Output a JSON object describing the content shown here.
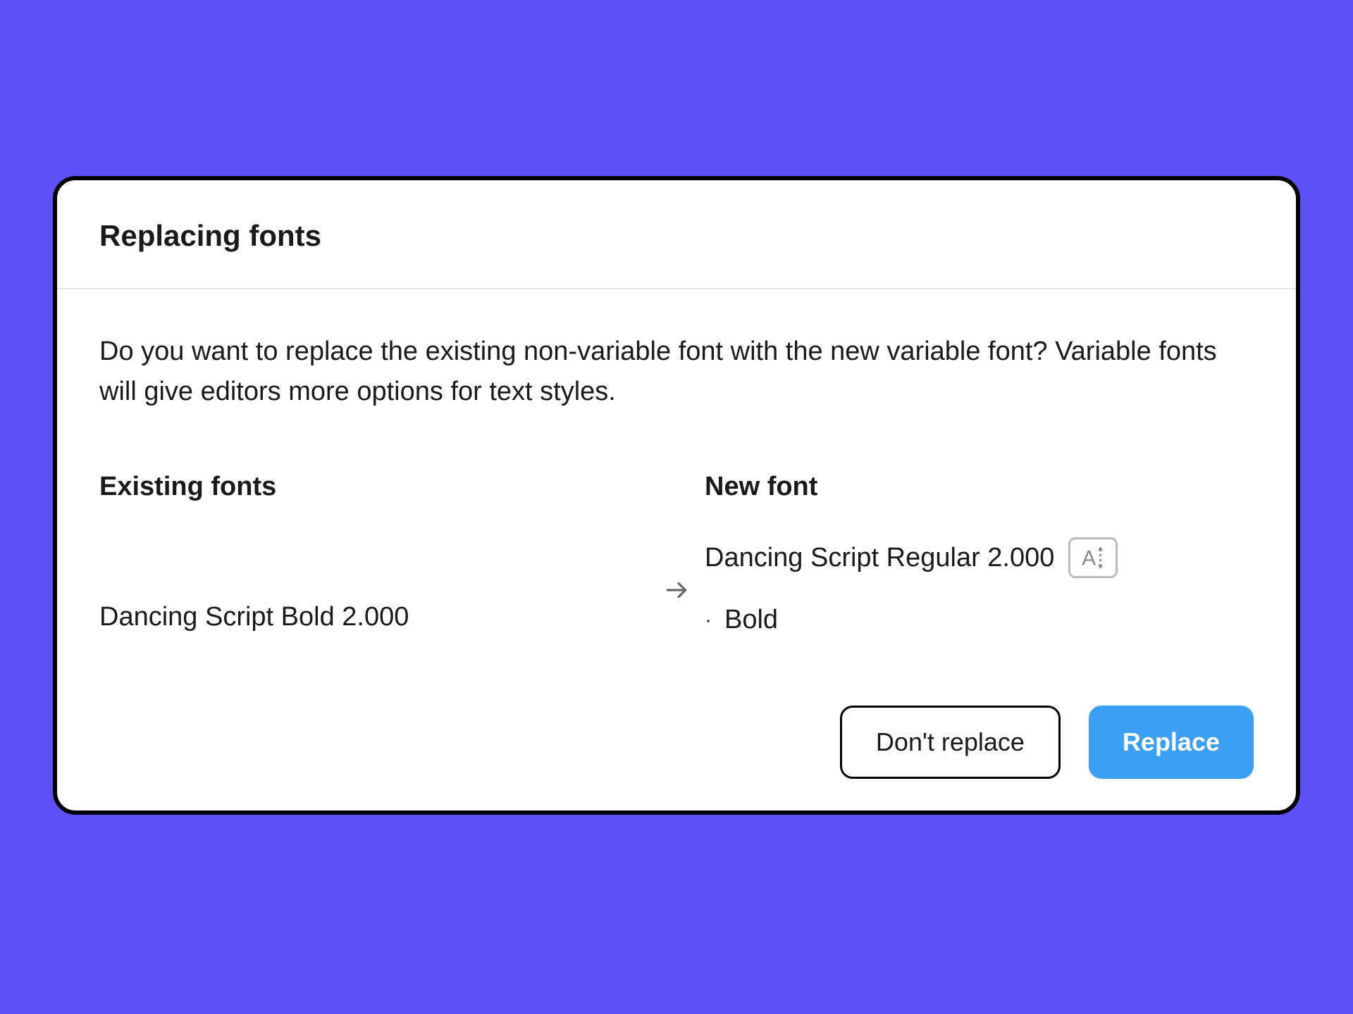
{
  "dialog": {
    "title": "Replacing fonts",
    "description": "Do you want to replace the existing non-variable font with the new variable font? Variable fonts will give editors more options for text styles.",
    "existing_heading": "Existing fonts",
    "new_heading": "New font",
    "existing_font": "Dancing Script Bold 2.000",
    "new_font": "Dancing Script Regular 2.000",
    "new_font_style": "Bold",
    "icons": {
      "variable_font": "variable-font-icon",
      "arrow": "arrow-right-icon"
    },
    "buttons": {
      "cancel": "Don't replace",
      "confirm": "Replace"
    }
  }
}
